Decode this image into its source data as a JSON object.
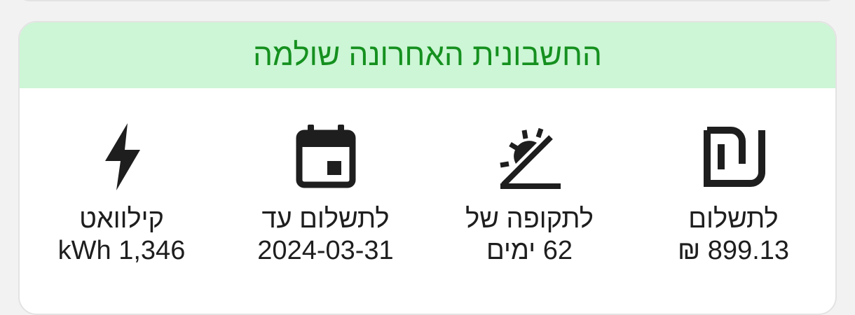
{
  "banner": {
    "title": "החשבונית האחרונה שולמה"
  },
  "stats": [
    {
      "icon": "shekel-icon",
      "label": "לתשלום",
      "value": "899.13 ₪"
    },
    {
      "icon": "sun-horizon-icon",
      "label": "לתקופה של",
      "value": "62 ימים"
    },
    {
      "icon": "calendar-icon",
      "label": "לתשלום עד",
      "value": "2024-03-31"
    },
    {
      "icon": "lightning-bolt-icon",
      "label": "קילוואט",
      "value": "1,346 kWh"
    }
  ],
  "colors": {
    "banner_bg": "#ccf6d5",
    "banner_text": "#15901f",
    "icon": "#1e1e1e"
  }
}
